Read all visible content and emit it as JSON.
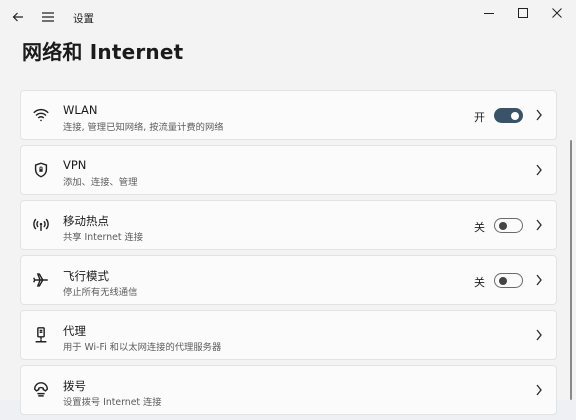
{
  "window": {
    "app_title": "设置",
    "back_icon": "back-arrow-icon",
    "menu_icon": "hamburger-icon",
    "minimize_icon": "minimize-icon",
    "maximize_icon": "maximize-icon",
    "close_icon": "close-icon"
  },
  "page": {
    "title": "网络和 Internet"
  },
  "settings": [
    {
      "icon": "wifi-icon",
      "title": "WLAN",
      "subtitle": "连接, 管理已知网络, 按流量计费的网络",
      "toggle": "on",
      "state_label": "开"
    },
    {
      "icon": "shield-icon",
      "title": "VPN",
      "subtitle": "添加、连接、管理",
      "toggle": null,
      "state_label": ""
    },
    {
      "icon": "hotspot-icon",
      "title": "移动热点",
      "subtitle": "共享 Internet 连接",
      "toggle": "off",
      "state_label": "关"
    },
    {
      "icon": "airplane-icon",
      "title": "飞行模式",
      "subtitle": "停止所有无线通信",
      "toggle": "off",
      "state_label": "关"
    },
    {
      "icon": "proxy-icon",
      "title": "代理",
      "subtitle": "用于 Wi-Fi 和以太网连接的代理服务器",
      "toggle": null,
      "state_label": ""
    },
    {
      "icon": "dialup-icon",
      "title": "拨号",
      "subtitle": "设置拨号 Internet 连接",
      "toggle": null,
      "state_label": ""
    }
  ],
  "colors": {
    "toggle_on": "#3a5368",
    "card_bg": "#fbfbfb",
    "window_bg": "#f3f3f3"
  }
}
